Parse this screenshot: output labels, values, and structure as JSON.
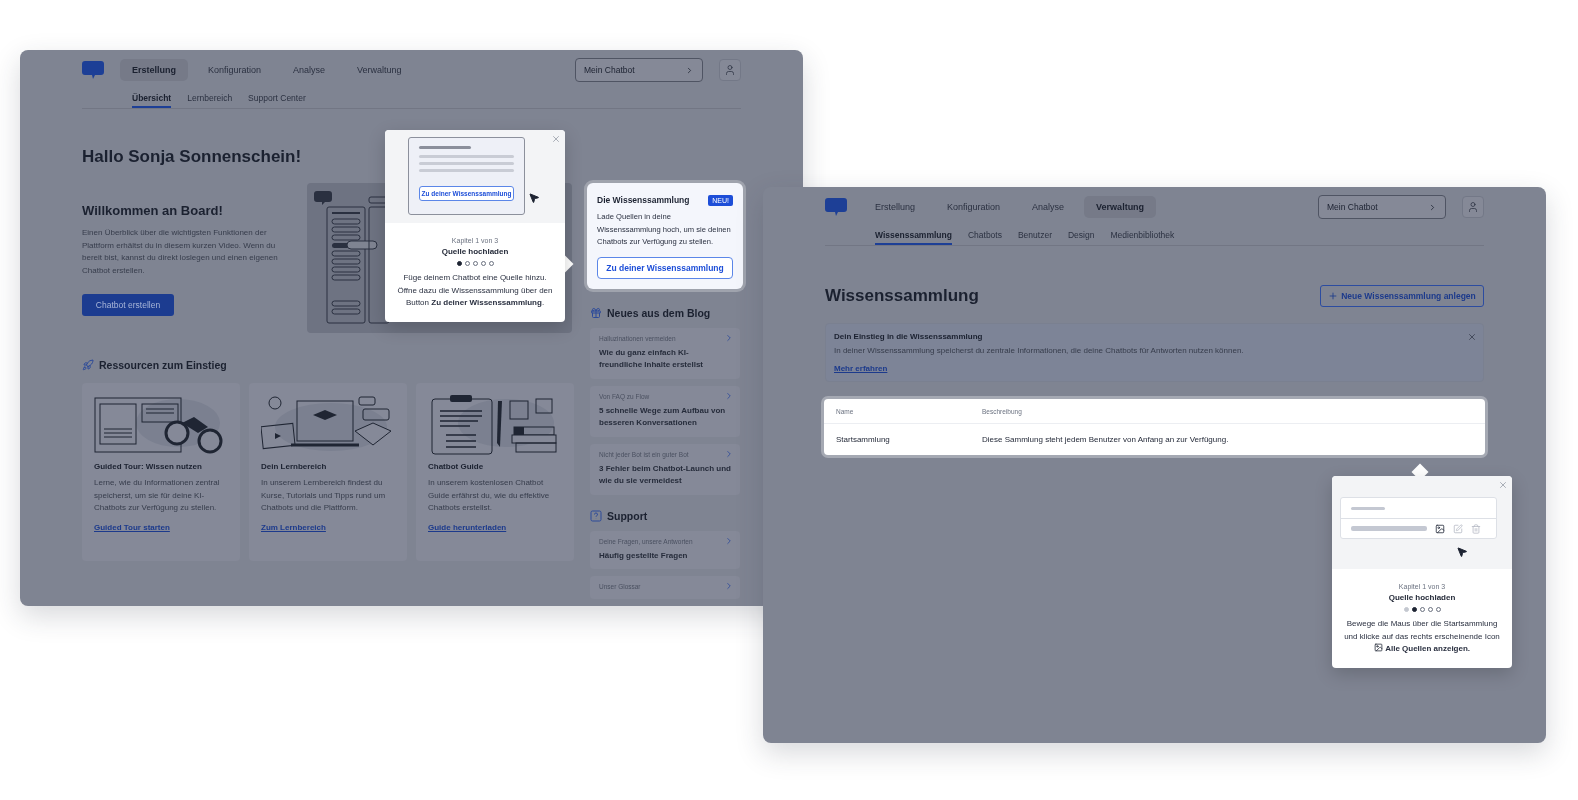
{
  "home_window": {
    "nav": [
      {
        "label": "Erstellung",
        "selected": true
      },
      {
        "label": "Konfiguration",
        "selected": false
      },
      {
        "label": "Analyse",
        "selected": false
      },
      {
        "label": "Verwaltung",
        "selected": false
      }
    ],
    "subnav": [
      {
        "label": "Übersicht",
        "selected": true
      },
      {
        "label": "Lernbereich",
        "selected": false
      },
      {
        "label": "Support Center",
        "selected": false
      }
    ],
    "chatbot_select": "Mein Chatbot",
    "greeting": "Hallo Sonja Sonnenschein!",
    "welcome": {
      "title": "Willkommen an Board!",
      "text": "Einen Überblick über die wichtigsten Funktionen der Plattform erhältst du in diesem kurzen Video. Wenn du bereit bist, kannst du direkt loslegen und einen eigenen Chatbot erstellen.",
      "button": "Chatbot erstellen"
    },
    "resources": {
      "title": "Ressourcen zum Einstieg",
      "cards": [
        {
          "kind": "binoculars",
          "title": "Guided Tour: Wissen nutzen",
          "text": "Lerne, wie du Informationen zentral speicherst, um sie für deine KI-Chatbots zur Verfügung zu stellen.",
          "link": "Guided Tour starten"
        },
        {
          "kind": "laptop",
          "title": "Dein Lernbereich",
          "text": "In unserem Lernbereich findest du Kurse, Tutorials und Tipps rund um Chatbots und die Plattform.",
          "link": "Zum Lernbereich"
        },
        {
          "kind": "clipboard",
          "title": "Chatbot Guide",
          "text": "In unserem kostenlosen Chatbot Guide erfährst du, wie du effektive Chatbots erstellst.",
          "link": "Guide herunterladen"
        }
      ]
    },
    "feature": {
      "title": "Die Wissenssammlung",
      "badge": "NEU!",
      "text": "Lade Quellen in deine Wissenssammlung hoch, um sie deinen Chatbots zur Verfügung zu stellen.",
      "button": "Zu deiner Wissenssammlung"
    },
    "blog": {
      "title": "Neues aus dem Blog",
      "items": [
        {
          "kicker": "Halluzinationen vermeiden",
          "title": "Wie du ganz einfach KI-freundliche Inhalte erstellst"
        },
        {
          "kicker": "Von FAQ zu Flow",
          "title": "5 schnelle Wege zum Aufbau von besseren Konversationen"
        },
        {
          "kicker": "Nicht jeder Bot ist ein guter Bot",
          "title": "3 Fehler beim Chatbot-Launch und wie du sie vermeidest"
        }
      ]
    },
    "support": {
      "title": "Support",
      "items": [
        {
          "kicker": "Deine Fragen, unsere Antworten",
          "title": "Häufig gestellte Fragen"
        },
        {
          "kicker": "Unser Glossar"
        }
      ]
    },
    "tour": {
      "preview_button": "Zu deiner Wissenssammlung",
      "chapter": "Kapitel 1 von 3",
      "title": "Quelle hochladen",
      "steps": [
        {
          "selected": true,
          "done": false
        },
        {
          "selected": false,
          "done": false
        },
        {
          "selected": false,
          "done": false
        },
        {
          "selected": false,
          "done": false
        },
        {
          "selected": false,
          "done": false
        }
      ],
      "text": "Füge deinem Chatbot eine Quelle hinzu. Öffne dazu die Wissenssammlung über den Button **Zu deiner Wissenssammlung**."
    }
  },
  "knowledge_window": {
    "nav": [
      {
        "label": "Erstellung",
        "selected": false
      },
      {
        "label": "Konfiguration",
        "selected": false
      },
      {
        "label": "Analyse",
        "selected": false
      },
      {
        "label": "Verwaltung",
        "selected": true
      }
    ],
    "subnav": [
      {
        "label": "Wissenssammlung",
        "selected": true
      },
      {
        "label": "Chatbots",
        "selected": false
      },
      {
        "label": "Benutzer",
        "selected": false
      },
      {
        "label": "Design",
        "selected": false
      },
      {
        "label": "Medienbibliothek",
        "selected": false
      }
    ],
    "chatbot_select": "Mein Chatbot",
    "title": "Wissenssammlung",
    "new_button": "Neue Wissenssammlung anlegen",
    "banner": {
      "title": "Dein Einstieg in die Wissenssammlung",
      "text": "In deiner Wissenssammlung speicherst du zentrale Informationen, die deine Chatbots für Antworten nutzen können.",
      "link": "Mehr erfahren"
    },
    "table": {
      "columns": [
        "Name",
        "Beschreibung"
      ],
      "rows": [
        [
          "Startsammlung",
          "Diese Sammlung steht jedem Benutzer von Anfang an zur Verfügung."
        ]
      ]
    },
    "tour": {
      "chapter": "Kapitel 1 von 3",
      "title": "Quelle hochladen",
      "steps": [
        {
          "selected": false,
          "done": true
        },
        {
          "selected": true,
          "done": false
        },
        {
          "selected": false,
          "done": false
        },
        {
          "selected": false,
          "done": false
        },
        {
          "selected": false,
          "done": false
        }
      ],
      "text": "Bewege die Maus über die Startsammlung und klicke auf das rechts erscheinende Icon",
      "action": "Alle Quellen anzeigen."
    }
  }
}
